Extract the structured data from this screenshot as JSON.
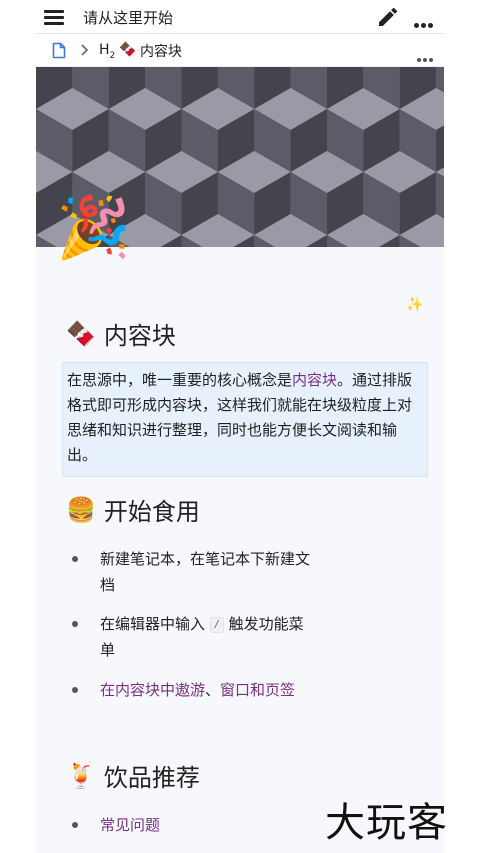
{
  "topbar": {
    "title": "请从这里开始"
  },
  "breadcrumb": {
    "heading_level": "H",
    "heading_sub": "2",
    "emoji": "🍫",
    "label": "内容块"
  },
  "sections": [
    {
      "emoji": "🍫",
      "title": "内容块"
    },
    {
      "emoji": "🍔",
      "title": "开始食用"
    },
    {
      "emoji": "🍹",
      "title": "饮品推荐"
    }
  ],
  "callout": {
    "prefix": "在思源中，唯一重要的核心概念是",
    "link": "内容块",
    "suffix": "。通过排版格式即可形成内容块，这样我们就能在块级粒度上对思绪和知识进行整理，同时也能方便长文阅读和输出。"
  },
  "list1": [
    {
      "text": "新建笔记本，在笔记本下新建文档"
    },
    {
      "before": "在编辑器中输入",
      "kbd": "/",
      "after": "触发功能菜单"
    },
    {
      "link1": "在内容块中遨游",
      "sep": "、",
      "link2": "窗口和页签"
    }
  ],
  "list2": [
    {
      "link": "常见问题"
    }
  ],
  "decor": {
    "party": "🎉",
    "sparkle": "✨"
  },
  "watermark": "大玩客",
  "colors": {
    "link": "#7a2e87",
    "callout_bg": "#e6f1fb"
  }
}
